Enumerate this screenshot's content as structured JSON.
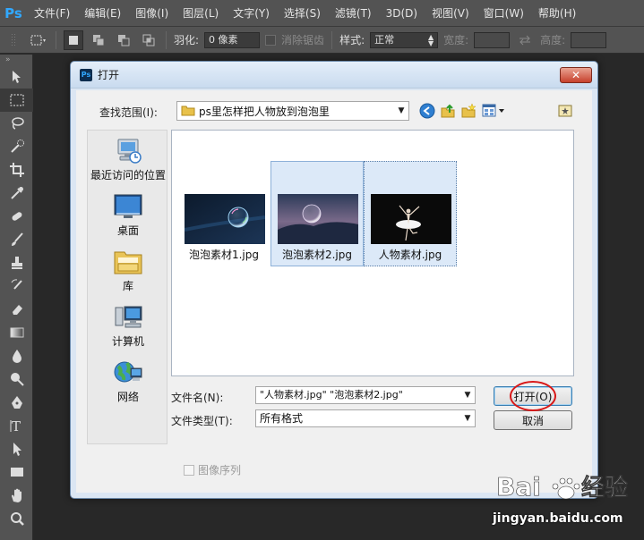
{
  "app": {
    "logo_text": "Ps"
  },
  "menubar": {
    "items": [
      "文件(F)",
      "编辑(E)",
      "图像(I)",
      "图层(L)",
      "文字(Y)",
      "选择(S)",
      "滤镜(T)",
      "3D(D)",
      "视图(V)",
      "窗口(W)",
      "帮助(H)"
    ]
  },
  "options_bar": {
    "feather_label": "羽化:",
    "feather_value": "0 像素",
    "antialias_label": "消除锯齿",
    "style_label": "样式:",
    "style_value": "正常",
    "width_label": "宽度:",
    "height_label": "高度:"
  },
  "dialog": {
    "title": "打开",
    "icon_text": "Ps",
    "look_in_label": "查找范围(I):",
    "look_in_value": "ps里怎样把人物放到泡泡里",
    "places": [
      {
        "label": "最近访问的位置",
        "icon": "recent-places-icon"
      },
      {
        "label": "桌面",
        "icon": "desktop-icon"
      },
      {
        "label": "库",
        "icon": "libraries-icon"
      },
      {
        "label": "计算机",
        "icon": "computer-icon"
      },
      {
        "label": "网络",
        "icon": "network-icon"
      }
    ],
    "files": [
      {
        "name": "泡泡素材1.jpg",
        "selected": false
      },
      {
        "name": "泡泡素材2.jpg",
        "selected": true
      },
      {
        "name": "人物素材.jpg",
        "selected": true
      }
    ],
    "file_name_label": "文件名(N):",
    "file_name_value": "\"人物素材.jpg\" \"泡泡素材2.jpg\"",
    "file_type_label": "文件类型(T):",
    "file_type_value": "所有格式",
    "open_button": "打开(O)",
    "cancel_button": "取消",
    "image_sequence_label": "图像序列"
  },
  "watermark": {
    "url": "jingyan.baidu.com"
  },
  "colors": {
    "ps_blue": "#31a8ff",
    "chrome_gray": "#535353",
    "highlight_red": "#d81818",
    "selection_blue": "#dce9f8"
  }
}
